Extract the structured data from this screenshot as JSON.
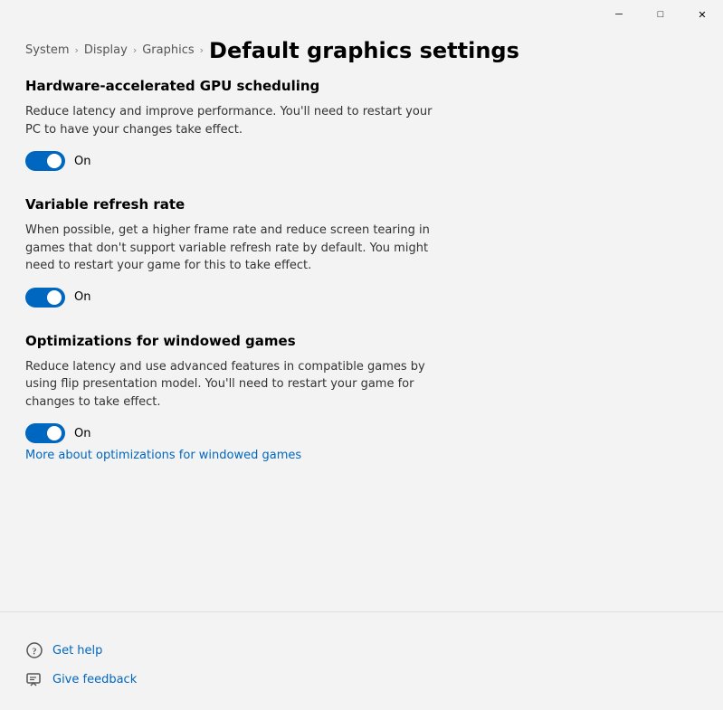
{
  "window": {
    "title": "Default graphics settings"
  },
  "title_bar": {
    "minimize_label": "─",
    "maximize_label": "□",
    "close_label": "✕"
  },
  "breadcrumb": {
    "items": [
      {
        "label": "System",
        "id": "system"
      },
      {
        "label": "Display",
        "id": "display"
      },
      {
        "label": "Graphics",
        "id": "graphics"
      }
    ],
    "current": "Default graphics settings"
  },
  "sections": {
    "gpu_scheduling": {
      "title": "Hardware-accelerated GPU scheduling",
      "description": "Reduce latency and improve performance. You'll need to restart your PC to have your changes take effect.",
      "toggle_state": "On",
      "toggle_id": "gpu-toggle"
    },
    "variable_refresh": {
      "title": "Variable refresh rate",
      "description": "When possible, get a higher frame rate and reduce screen tearing in games that don't support variable refresh rate by default. You might need to restart your game for this to take effect.",
      "toggle_state": "On",
      "toggle_id": "vrr-toggle"
    },
    "windowed_games": {
      "title": "Optimizations for windowed games",
      "description": "Reduce latency and use advanced features in compatible games by using flip presentation model. You'll need to restart your game for changes to take effect.",
      "toggle_state": "On",
      "toggle_id": "windowed-toggle",
      "link": "More about optimizations for windowed games"
    }
  },
  "footer": {
    "get_help": "Get help",
    "give_feedback": "Give feedback"
  }
}
